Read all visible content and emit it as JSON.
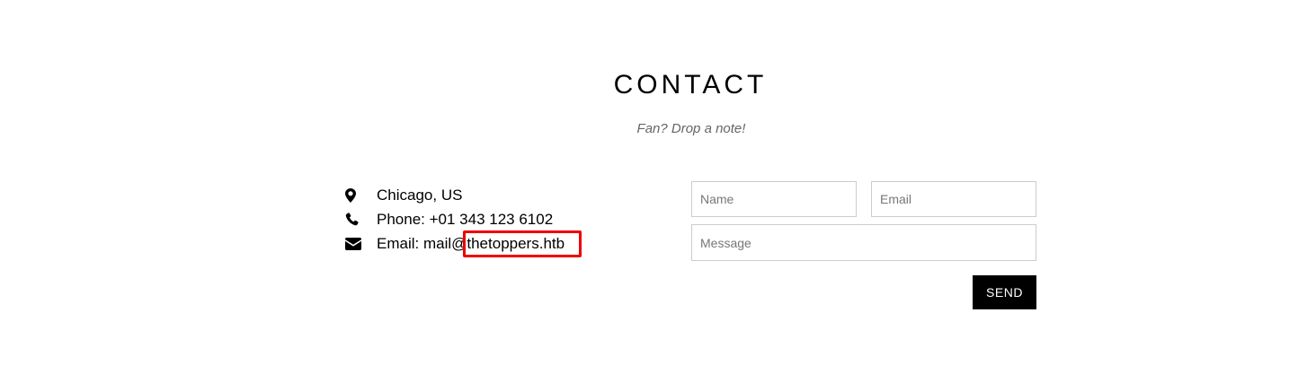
{
  "contact": {
    "title": "CONTACT",
    "subtitle": "Fan? Drop a note!",
    "info": [
      {
        "icon": "map-marker-icon",
        "text": "Chicago, US"
      },
      {
        "icon": "phone-icon",
        "text": "Phone: +01 343 123 6102"
      },
      {
        "icon": "envelope-icon",
        "text": "Email: mail@thetoppers.htb"
      }
    ],
    "highlight_color": "#ee0000"
  },
  "form": {
    "name_placeholder": "Name",
    "email_placeholder": "Email",
    "message_placeholder": "Message",
    "send_label": "SEND"
  }
}
